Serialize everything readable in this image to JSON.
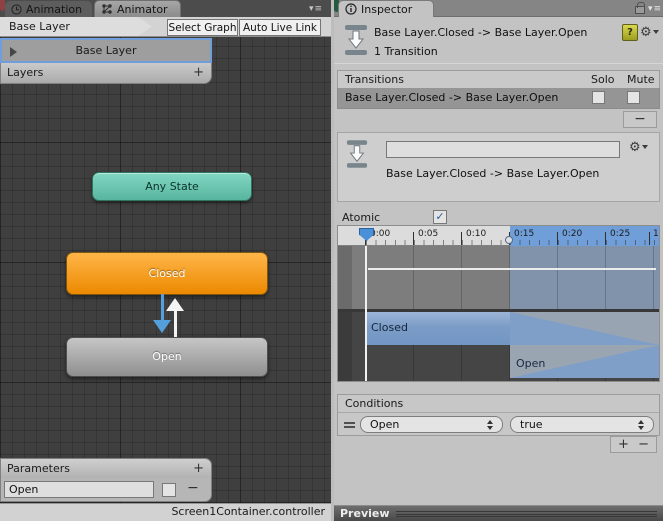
{
  "icons": {
    "menu": "▾≡",
    "gear": "⚙",
    "check": "✓",
    "help": "?",
    "add": "+",
    "remove": "−"
  },
  "colors": {
    "accent_blue": "#6f9edb",
    "node_orange": "#f0940a",
    "node_teal": "#63c1a9",
    "node_gray": "#a8a8a8",
    "timeline_ruler_blue": "#6f9ed8",
    "transition_bar_blue": "#7f9fc8",
    "selected_row_gray": "#959595",
    "graph_background": "#3f3f3f"
  },
  "left": {
    "tabs": [
      {
        "label": "Animation"
      },
      {
        "label": "Animator"
      }
    ],
    "breadcrumb": {
      "label": "Base Layer"
    },
    "toolbar": {
      "select_graph": "Select Graph",
      "auto_live_link": "Auto Live Link"
    },
    "layers": {
      "selected_item": "Base Layer",
      "header": "Layers",
      "add": "+"
    },
    "graph": {
      "any_state": "Any State",
      "closed": "Closed",
      "open": "Open"
    },
    "parameters": {
      "header": "Parameters",
      "add": "+",
      "row": {
        "name": "Open"
      },
      "remove": "−"
    },
    "status": "Screen1Container.controller"
  },
  "right": {
    "tab": "Inspector",
    "header": {
      "title": "Base Layer.Closed -> Base Layer.Open",
      "subtitle": "1 Transition"
    },
    "transitions": {
      "title": "Transitions",
      "solo": "Solo",
      "mute": "Mute",
      "row": "Base Layer.Closed -> Base Layer.Open",
      "remove": "−"
    },
    "detail": {
      "name_field": "",
      "label": "Base Layer.Closed -> Base Layer.Open"
    },
    "atomic": {
      "label": "Atomic",
      "checked": true
    },
    "timeline": {
      "ticks": [
        "0:00",
        "0:05",
        "0:10",
        "0:15",
        "0:20",
        "0:25",
        "1"
      ],
      "closed_bar": "Closed",
      "open_bar": "Open"
    },
    "conditions": {
      "title": "Conditions",
      "param": "Open",
      "value": "true",
      "add": "+",
      "remove": "−"
    },
    "preview": "Preview"
  }
}
